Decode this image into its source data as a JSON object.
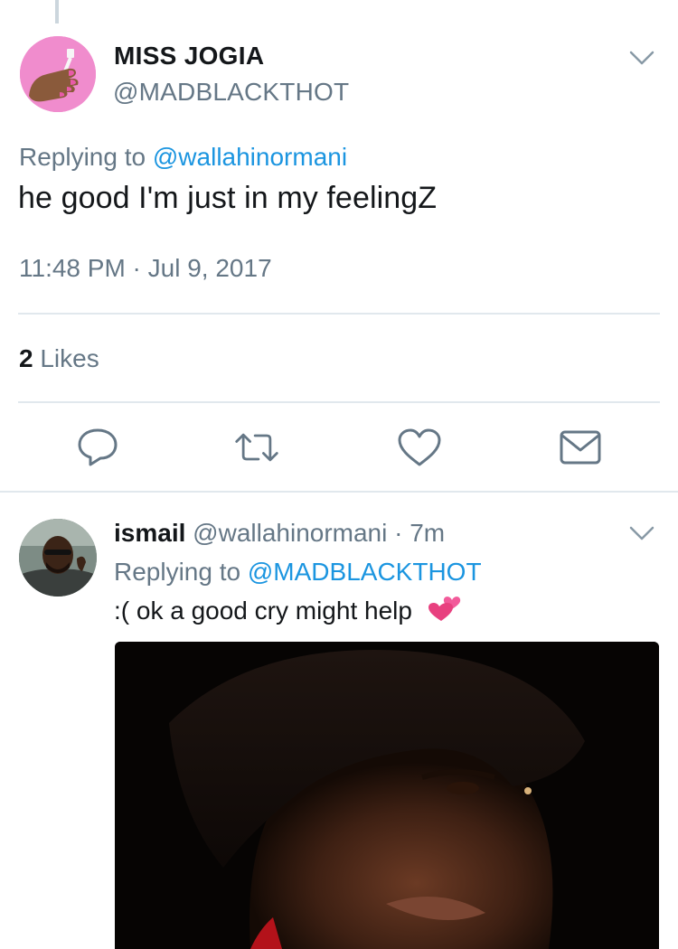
{
  "main_tweet": {
    "display_name": "MISS JOGIA",
    "handle": "@MADBLACKTHOT",
    "replying_prefix": "Replying to",
    "replying_to": "@wallahinormani",
    "text": "he good I'm just in my feelingZ",
    "timestamp": "11:48 PM · Jul 9, 2017",
    "likes_count": "2",
    "likes_label": "Likes",
    "avatar_icon": "painted-nails-icon",
    "actions": [
      "reply-icon",
      "retweet-icon",
      "like-icon",
      "message-icon"
    ]
  },
  "reply_tweet": {
    "display_name": "ismail",
    "handle_and_time": "@wallahinormani · 7m",
    "replying_prefix": "Replying to",
    "replying_to": "@MADBLACKTHOT",
    "text": ":( ok a good cry might help",
    "emoji": "two-hearts-icon",
    "media_type": "photo"
  },
  "colors": {
    "primary_text": "#14171a",
    "secondary_text": "#657786",
    "link": "#1b95e0",
    "divider": "#e1e8ed",
    "icon_gray": "#657786",
    "avatar_pink": "#f08ccd"
  }
}
